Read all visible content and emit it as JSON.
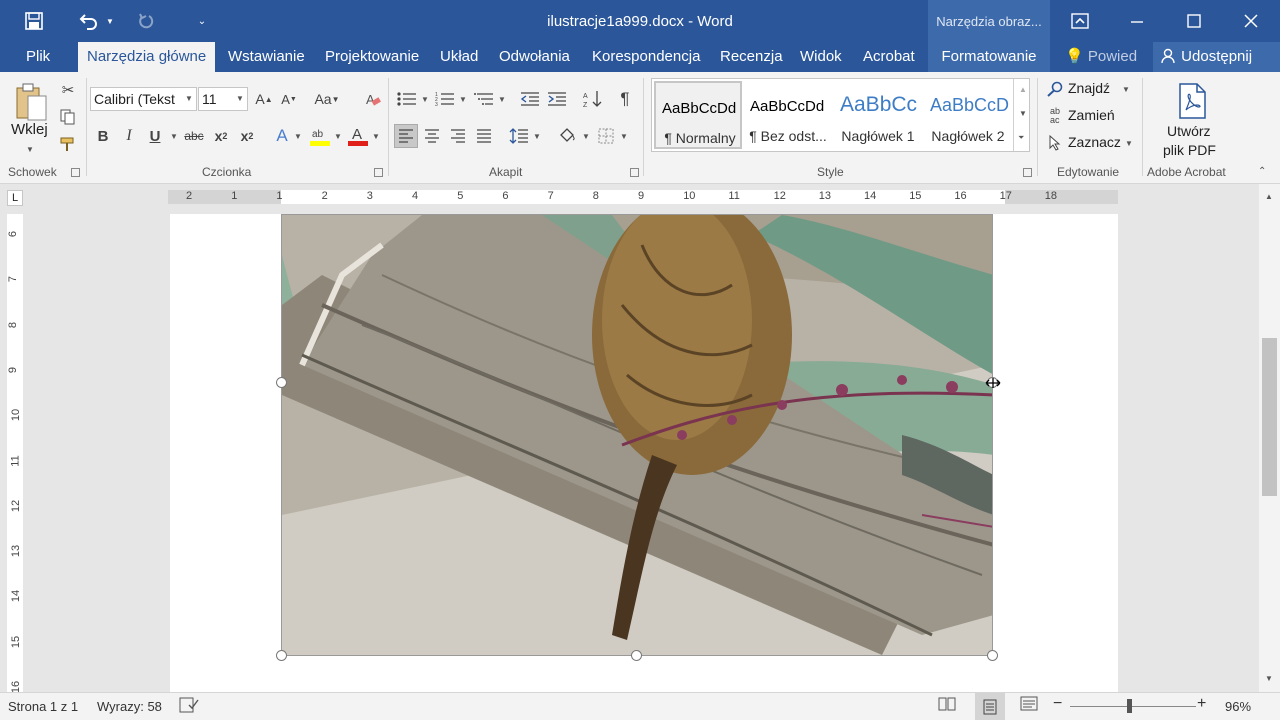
{
  "titlebar": {
    "document_title": "ilustracje1a999.docx - Word",
    "context_title": "Narzędzia obraz..."
  },
  "tabs": {
    "file": "Plik",
    "home": "Narzędzia główne",
    "insert": "Wstawianie",
    "design": "Projektowanie",
    "layout": "Układ",
    "references": "Odwołania",
    "mailings": "Korespondencja",
    "review": "Recenzja",
    "view": "Widok",
    "acrobat": "Acrobat",
    "format": "Formatowanie",
    "tell_me": "Powied",
    "share": "Udostępnij"
  },
  "ribbon": {
    "clipboard": {
      "paste": "Wklej",
      "label": "Schowek"
    },
    "font": {
      "font_name": "Calibri (Tekst",
      "font_size": "11",
      "label": "Czcionka"
    },
    "paragraph": {
      "label": "Akapit"
    },
    "styles": {
      "label": "Style",
      "items": [
        {
          "sample": "AaBbCcDd",
          "name": "¶ Normalny"
        },
        {
          "sample": "AaBbCcDd",
          "name": "¶ Bez odst..."
        },
        {
          "sample": "AaBbCc",
          "name": "Nagłówek 1"
        },
        {
          "sample": "AaBbCcD",
          "name": "Nagłówek 2"
        }
      ]
    },
    "editing": {
      "find": "Znajdź",
      "replace": "Zamień",
      "select": "Zaznacz",
      "label": "Edytowanie"
    },
    "acrobat": {
      "create_pdf_line1": "Utwórz",
      "create_pdf_line2": "plik PDF",
      "label": "Adobe Acrobat"
    }
  },
  "ruler": {
    "horizontal_labels": [
      "2",
      "1",
      "1",
      "2",
      "3",
      "4",
      "5",
      "6",
      "7",
      "8",
      "9",
      "10",
      "11",
      "12",
      "13",
      "14",
      "15",
      "16",
      "17",
      "18"
    ],
    "vertical_labels": [
      "6",
      "7",
      "8",
      "9",
      "10",
      "11",
      "12",
      "13",
      "14",
      "15",
      "16"
    ]
  },
  "status": {
    "page": "Strona 1 z 1",
    "words": "Wyrazy: 58",
    "zoom": "96%"
  },
  "colors": {
    "word_blue": "#2b579a",
    "ribbon_bg": "#f3f3f3",
    "highlight_yellow": "#ffff00",
    "font_color_red": "#e0201a"
  }
}
